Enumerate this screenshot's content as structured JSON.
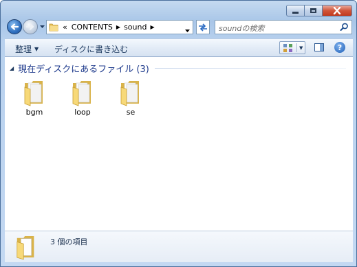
{
  "window": {
    "controls": {
      "minimize_icon": "minimize-icon",
      "maximize_icon": "maximize-icon",
      "close_icon": "close-icon"
    }
  },
  "nav": {
    "overflow_chevron": "«",
    "path": [
      "CONTENTS",
      "sound"
    ],
    "search_placeholder": "soundの検索"
  },
  "toolbar": {
    "organize_label": "整理",
    "burn_label": "ディスクに書き込む"
  },
  "content": {
    "group_header": "現在ディスクにあるファイル (3)",
    "items": [
      {
        "name": "bgm",
        "icon": "folder-icon"
      },
      {
        "name": "loop",
        "icon": "folder-icon"
      },
      {
        "name": "se",
        "icon": "folder-icon"
      }
    ]
  },
  "details": {
    "item_count": "3 個の項目"
  },
  "colors": {
    "header_text": "#1e3a8c",
    "folder_yellow": "#f2cf6b",
    "close_red": "#c13a1e"
  }
}
